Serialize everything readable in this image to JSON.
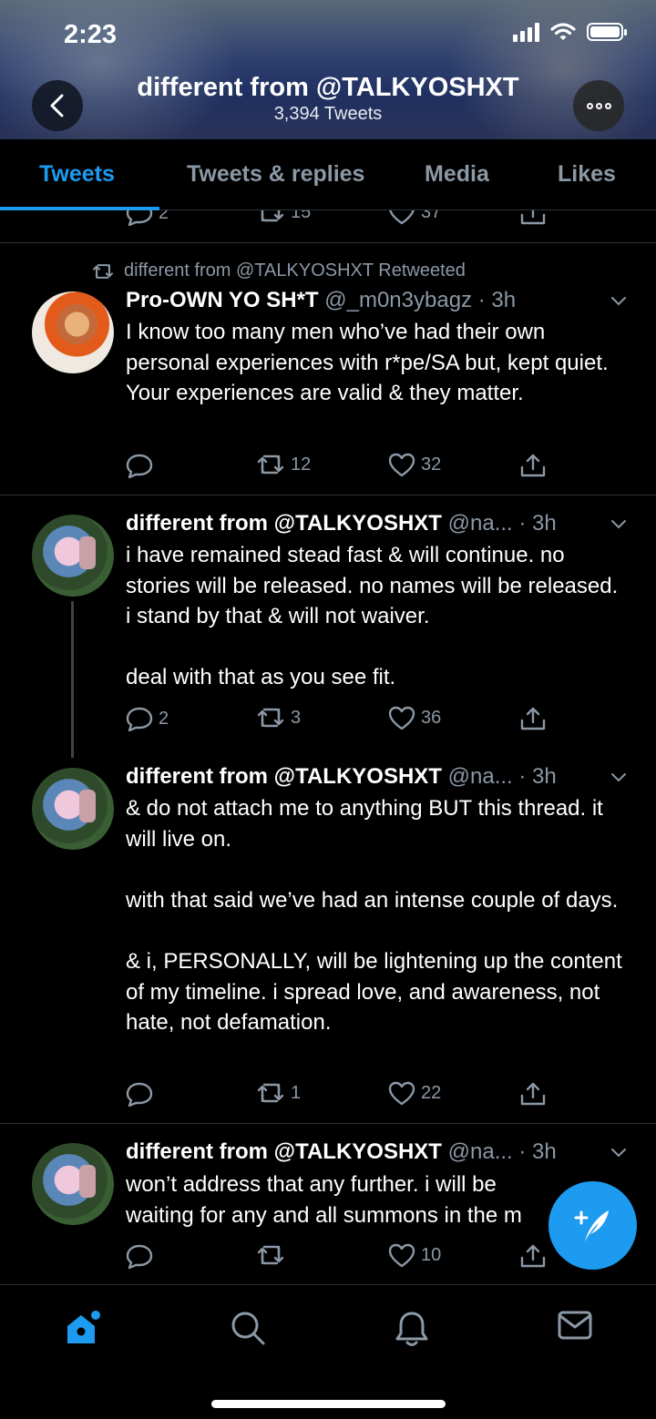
{
  "status_bar": {
    "time": "2:23"
  },
  "header": {
    "title": "different from @TALKYOSHXT",
    "tweet_count": "3,394 Tweets"
  },
  "tabs": [
    {
      "label": "Tweets",
      "active": true
    },
    {
      "label": "Tweets & replies",
      "active": false
    },
    {
      "label": "Media",
      "active": false
    },
    {
      "label": "Likes",
      "active": false
    }
  ],
  "partial_tweet": {
    "replies": "2",
    "retweets": "15",
    "likes": "37"
  },
  "tweets": [
    {
      "retweet_label": "different from @TALKYOSHXT Retweeted",
      "name": "Pro-OWN YO SH*T",
      "meta": "@_m0n3ybagz · 3h",
      "text": "I know too many men who’ve had their own personal experiences with r*pe/SA but, kept quiet. Your experiences are valid & they matter.",
      "replies": "",
      "retweets": "12",
      "likes": "32"
    },
    {
      "name": "different from @TALKYOSHXT",
      "meta": "@na... · 3h",
      "text": "i have remained stead fast & will continue. no stories will be released. no names will be released. i stand by that & will not waiver.\n\ndeal with that as you see fit.",
      "replies": "2",
      "retweets": "3",
      "likes": "36"
    },
    {
      "name": "different from @TALKYOSHXT",
      "meta": "@na... · 3h",
      "text": "& do not attach me to anything BUT this thread. it will live on.\n\nwith that said we’ve had an intense couple of days.\n\n& i, PERSONALLY, will be lightening up the content of my timeline. i spread love, and awareness, not hate, not defamation.",
      "replies": "",
      "retweets": "1",
      "likes": "22"
    },
    {
      "name": "different from @TALKYOSHXT",
      "meta": "@na... · 3h",
      "text": "won’t address that any further. i will be waiting for any and all summons in the m",
      "replies": "",
      "retweets": "",
      "likes": "10"
    }
  ],
  "colors": {
    "accent": "#1d9bf0",
    "muted": "#8b98a5",
    "background": "#000000"
  },
  "icons": {
    "back": "back-arrow-icon",
    "more": "more-icon",
    "reply": "reply-icon",
    "retweet": "retweet-icon",
    "like": "heart-icon",
    "share": "share-icon",
    "compose": "compose-tweet-icon",
    "nav": [
      "home-icon",
      "search-icon",
      "notifications-icon",
      "messages-icon"
    ]
  }
}
